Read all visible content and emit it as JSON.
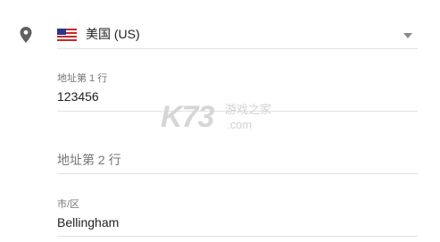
{
  "location": {
    "icon": "location-pin-icon"
  },
  "country": {
    "flag_icon": "us-flag-icon",
    "selected_value": "美国 (US)",
    "dropdown_icon": "dropdown-arrow-icon"
  },
  "address_line_1": {
    "label": "地址第 1 行",
    "value": "123456"
  },
  "address_line_2": {
    "placeholder": "地址第 2 行"
  },
  "city": {
    "label": "市/区",
    "value": "Bellingham"
  },
  "watermark": {
    "brand": "K73",
    "site_name": "游戏之家",
    "domain": ".com"
  }
}
